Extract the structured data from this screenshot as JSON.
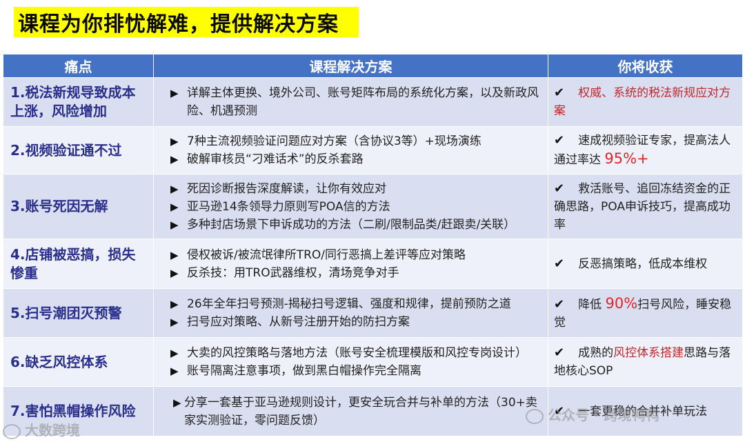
{
  "title": "课程为你排忧解难，提供解决方案",
  "headers": {
    "pain": "痛点",
    "solution": "课程解决方案",
    "gain": "你将收获"
  },
  "check": "✔",
  "bullet": "▶",
  "rows": [
    {
      "pain": "1.税法新规导致成本上涨，风险增加",
      "solutions": [
        "详解主体更换、境外公司、账号矩阵布局的系统化方案，以及新政风险、机遇预测"
      ],
      "gain": {
        "pre": "",
        "red": "权威、系统的税法新规应对方案",
        "big": "",
        "post": ""
      }
    },
    {
      "pain": "2.视频验证通不过",
      "solutions": [
        "7种主流视频验证问题应对方案（含协议3等）+现场演练",
        "破解审核员“刁难话术”的反杀套路"
      ],
      "gain": {
        "pre": "速成视频验证专家，提高法人通过率达 ",
        "red": "",
        "big": "95%+",
        "post": ""
      }
    },
    {
      "pain": "3.账号死因无解",
      "solutions": [
        "死因诊断报告深度解读，让你有效应对",
        "亚马逊14条领导力原则写POA信的方法",
        "多种封店场景下申诉成功的方法（二刷/限制品类/赶跟卖/关联）"
      ],
      "gain": {
        "pre": "救活账号、追回冻结资金的正确思路，POA申诉技巧，提高成功率",
        "red": "",
        "big": "",
        "post": ""
      }
    },
    {
      "pain": "4.店铺被恶搞，损失惨重",
      "solutions": [
        "侵权被诉/被流氓律所TRO/同行恶搞上差评等应对策略",
        "反杀技：用TRO武器维权，清场竞争对手"
      ],
      "gain": {
        "pre": "反恶搞策略，低成本维权",
        "red": "",
        "big": "",
        "post": ""
      }
    },
    {
      "pain": "5.扫号潮团灭预警",
      "solutions": [
        "26年全年扫号预测-揭秘扫号逻辑、强度和规律，提前预防之道",
        "扫号应对策略、从新号注册开始的防扫方案"
      ],
      "gain": {
        "pre": "降低 ",
        "red": "",
        "big": "90%",
        "post": "扫号风险，睡安稳觉"
      }
    },
    {
      "pain": "6.缺乏风控体系",
      "solutions": [
        "大卖的风控策略与落地方法（账号安全梳理模版和风控专岗设计）",
        "账号隔离注意事项，做到黑白帽操作完全隔离"
      ],
      "gain": {
        "pre": "成熟的",
        "red": "风控体系搭建",
        "big": "",
        "post": "思路与落地核心SOP"
      }
    },
    {
      "pain": "7.害怕黑帽操作风险",
      "solutions": [
        "分享一套基于亚马逊规则设计，更安全玩合并与补单的方法（30+卖家实测验证，零问题反馈）"
      ],
      "gain": {
        "pre": "一套更稳的合并补单玩法",
        "red": "",
        "big": "",
        "post": ""
      }
    }
  ],
  "watermarks": {
    "left": "大数跨境",
    "right": "公众号 · 跨境鸭鸭"
  }
}
